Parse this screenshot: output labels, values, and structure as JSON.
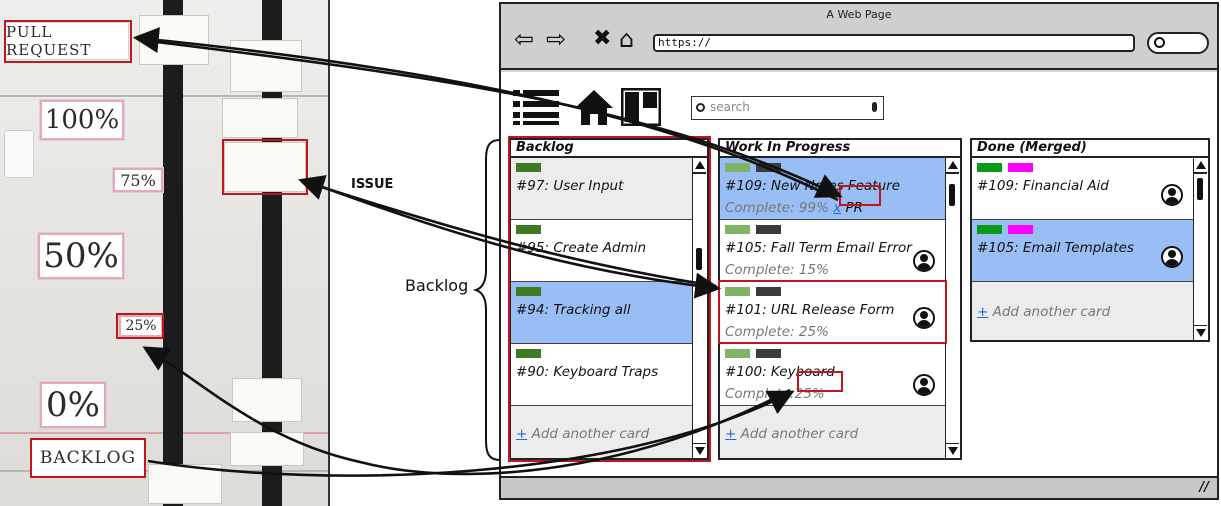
{
  "photo": {
    "signs": {
      "pull_request": "PULL REQUEST",
      "p100": "100%",
      "p75": "75%",
      "p50": "50%",
      "p25": "25%",
      "p0": "0%",
      "backlog": "BACKLOG"
    }
  },
  "annotations": {
    "backlog_label": "Backlog",
    "issue_label": "ISSUE"
  },
  "browser": {
    "title": "A Web Page",
    "url": "https://",
    "search_placeholder": "search",
    "columns": [
      {
        "name": "Backlog",
        "cards": [
          {
            "number": "#97",
            "title": ": User Input",
            "labels": [
              "#3d7a22"
            ]
          },
          {
            "number": "#95",
            "title": ": Create Admin",
            "labels": [
              "#3d7a22"
            ]
          },
          {
            "number": "#94",
            "title": ": Tracking all",
            "labels": [
              "#3d7a22"
            ]
          },
          {
            "number": "#90",
            "title": ": Keyboard Traps",
            "labels": [
              "#3d7a22"
            ]
          }
        ],
        "add_card": "Add another card"
      },
      {
        "name": "Work In Progress",
        "cards": [
          {
            "number": "#109",
            "title": ": New Notes Feature",
            "status": "Complete: 99%",
            "pr_x": "x",
            "pr": "PR",
            "labels": [
              "#7fb366",
              "#3b3b3b"
            ]
          },
          {
            "number": "#105",
            "title": ": Fall Term Email Error",
            "status": "Complete: 15%",
            "labels": [
              "#7fb366",
              "#3b3b3b"
            ]
          },
          {
            "number": "#101",
            "title": ": URL Release Form",
            "status": "Complete: 25%",
            "labels": [
              "#7fb366",
              "#3b3b3b"
            ]
          },
          {
            "number": "#100",
            "title": ": Keyboard",
            "status_prefix": "Complete:",
            "status_value": "25%",
            "labels": [
              "#7fb366",
              "#3b3b3b"
            ]
          }
        ],
        "add_card": "Add another card"
      },
      {
        "name": "Done (Merged)",
        "cards": [
          {
            "number": "#109",
            "title": ": Financial Aid",
            "labels": [
              "#0a9a1a",
              "#ff00ff"
            ]
          },
          {
            "number": "#105",
            "title": ": Email Templates",
            "labels": [
              "#0a9a1a",
              "#ff00ff"
            ]
          }
        ],
        "add_card": "Add another card"
      }
    ]
  },
  "colors": {
    "highlight": "#c0161d",
    "card_blue": "#99bdf5",
    "card_grey": "#ececec",
    "link_blue": "#2a66d6"
  }
}
